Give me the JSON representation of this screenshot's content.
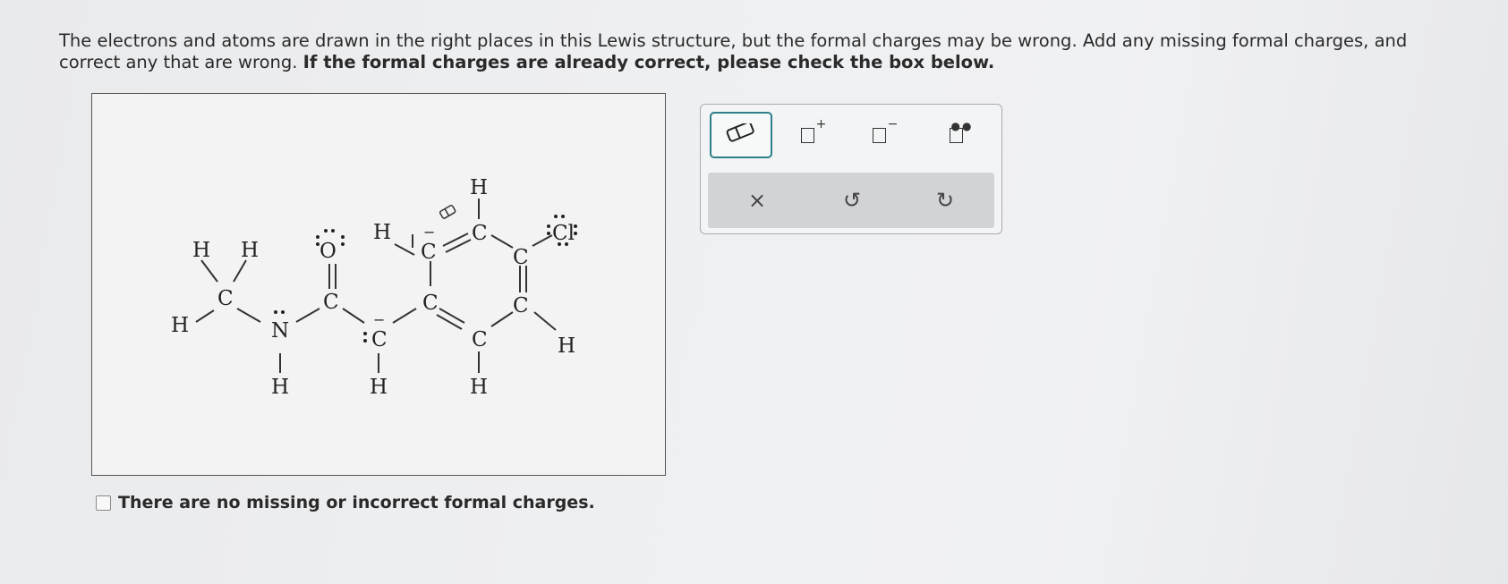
{
  "prompt": {
    "part1": "The electrons and atoms are drawn in the right places in this Lewis structure, but the formal charges may be wrong. Add any missing formal charges, and correct any that are wrong.",
    "part2": "If the formal charges are already correct, please check the box below."
  },
  "molecule": {
    "atoms": {
      "H": "H",
      "C": "C",
      "N": "N",
      "O": "O",
      "Cl": "Cl"
    },
    "charges": {
      "minus": "−"
    }
  },
  "checkbox": {
    "label": "There are no missing or incorrect formal charges.",
    "checked": false
  },
  "toolbar": {
    "tools": [
      "eraser-icon",
      "positive-charge-icon",
      "negative-charge-icon",
      "lone-pair-icon"
    ],
    "plus": "+",
    "minus": "−",
    "actions": {
      "clear": "×",
      "undo": "↺",
      "redo": "↻"
    }
  },
  "colors": {
    "selected_border": "#2d7f8a",
    "action_bar": "#d2d3d6"
  }
}
